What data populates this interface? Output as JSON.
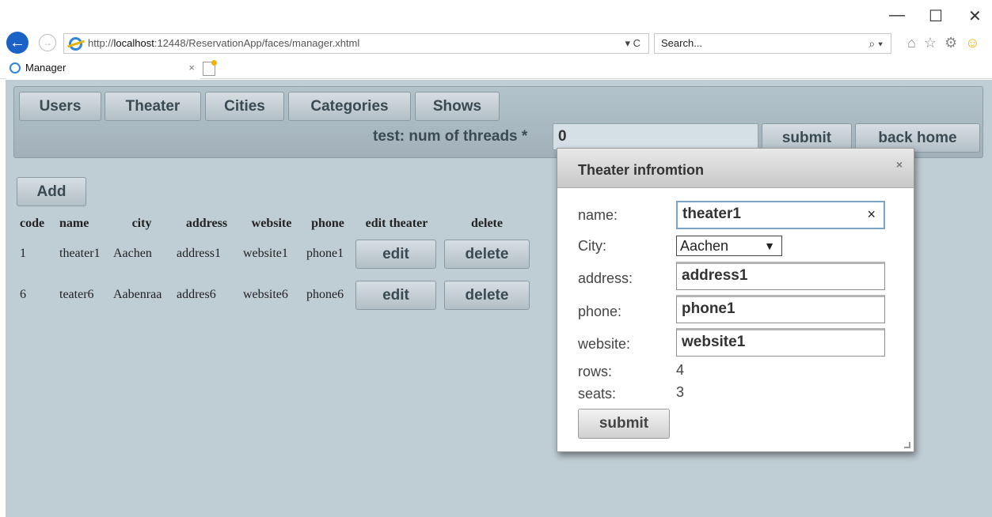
{
  "window": {
    "minimize": "—",
    "maximize": "☐",
    "close": "✕"
  },
  "browser": {
    "url_prefix": "http://",
    "url_host": "localhost",
    "url_rest": ":12448/ReservationApp/faces/manager.xhtml",
    "url_tools": "▾ C",
    "search_placeholder": "Search...",
    "search_tools": "⌕ ▾",
    "tab_title": "Manager",
    "tab_close": "×"
  },
  "menu": {
    "items": [
      "Users",
      "Theater",
      "Cities",
      "Categories",
      "Shows"
    ],
    "threads_label": "test: num of threads *",
    "threads_value": "0",
    "submit": "submit",
    "back_home": "back home"
  },
  "add_label": "Add",
  "table": {
    "headers": [
      "code",
      "name",
      "city",
      "address",
      "website",
      "phone",
      "edit theater",
      "delete"
    ],
    "rows": [
      {
        "code": "1",
        "name": "theater1",
        "city": "Aachen",
        "address": "address1",
        "website": "website1",
        "phone": "phone1",
        "edit": "edit",
        "delete": "delete"
      },
      {
        "code": "6",
        "name": "teater6",
        "city": "Aabenraa",
        "address": "addres6",
        "website": "website6",
        "phone": "phone6",
        "edit": "edit",
        "delete": "delete"
      }
    ]
  },
  "dialog": {
    "title": "Theater infromtion",
    "close": "×",
    "name_label": "name:",
    "name_value": "theater1",
    "clear": "×",
    "city_label": "City:",
    "city_value": "Aachen",
    "address_label": "address:",
    "address_value": "address1",
    "phone_label": "phone:",
    "phone_value": "phone1",
    "website_label": "website:",
    "website_value": "website1",
    "rows_label": "rows:",
    "rows_value": "4",
    "seats_label": "seats:",
    "seats_value": "3",
    "submit": "submit"
  }
}
